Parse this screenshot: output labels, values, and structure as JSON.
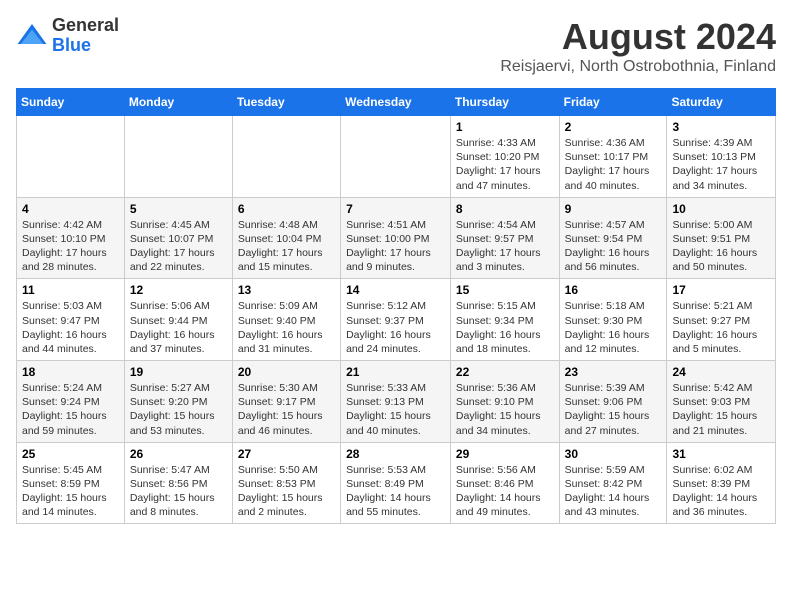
{
  "header": {
    "logo_general": "General",
    "logo_blue": "Blue",
    "month_year": "August 2024",
    "location": "Reisjaervi, North Ostrobothnia, Finland"
  },
  "weekdays": [
    "Sunday",
    "Monday",
    "Tuesday",
    "Wednesday",
    "Thursday",
    "Friday",
    "Saturday"
  ],
  "weeks": [
    [
      {
        "day": "",
        "text": ""
      },
      {
        "day": "",
        "text": ""
      },
      {
        "day": "",
        "text": ""
      },
      {
        "day": "",
        "text": ""
      },
      {
        "day": "1",
        "text": "Sunrise: 4:33 AM\nSunset: 10:20 PM\nDaylight: 17 hours and 47 minutes."
      },
      {
        "day": "2",
        "text": "Sunrise: 4:36 AM\nSunset: 10:17 PM\nDaylight: 17 hours and 40 minutes."
      },
      {
        "day": "3",
        "text": "Sunrise: 4:39 AM\nSunset: 10:13 PM\nDaylight: 17 hours and 34 minutes."
      }
    ],
    [
      {
        "day": "4",
        "text": "Sunrise: 4:42 AM\nSunset: 10:10 PM\nDaylight: 17 hours and 28 minutes."
      },
      {
        "day": "5",
        "text": "Sunrise: 4:45 AM\nSunset: 10:07 PM\nDaylight: 17 hours and 22 minutes."
      },
      {
        "day": "6",
        "text": "Sunrise: 4:48 AM\nSunset: 10:04 PM\nDaylight: 17 hours and 15 minutes."
      },
      {
        "day": "7",
        "text": "Sunrise: 4:51 AM\nSunset: 10:00 PM\nDaylight: 17 hours and 9 minutes."
      },
      {
        "day": "8",
        "text": "Sunrise: 4:54 AM\nSunset: 9:57 PM\nDaylight: 17 hours and 3 minutes."
      },
      {
        "day": "9",
        "text": "Sunrise: 4:57 AM\nSunset: 9:54 PM\nDaylight: 16 hours and 56 minutes."
      },
      {
        "day": "10",
        "text": "Sunrise: 5:00 AM\nSunset: 9:51 PM\nDaylight: 16 hours and 50 minutes."
      }
    ],
    [
      {
        "day": "11",
        "text": "Sunrise: 5:03 AM\nSunset: 9:47 PM\nDaylight: 16 hours and 44 minutes."
      },
      {
        "day": "12",
        "text": "Sunrise: 5:06 AM\nSunset: 9:44 PM\nDaylight: 16 hours and 37 minutes."
      },
      {
        "day": "13",
        "text": "Sunrise: 5:09 AM\nSunset: 9:40 PM\nDaylight: 16 hours and 31 minutes."
      },
      {
        "day": "14",
        "text": "Sunrise: 5:12 AM\nSunset: 9:37 PM\nDaylight: 16 hours and 24 minutes."
      },
      {
        "day": "15",
        "text": "Sunrise: 5:15 AM\nSunset: 9:34 PM\nDaylight: 16 hours and 18 minutes."
      },
      {
        "day": "16",
        "text": "Sunrise: 5:18 AM\nSunset: 9:30 PM\nDaylight: 16 hours and 12 minutes."
      },
      {
        "day": "17",
        "text": "Sunrise: 5:21 AM\nSunset: 9:27 PM\nDaylight: 16 hours and 5 minutes."
      }
    ],
    [
      {
        "day": "18",
        "text": "Sunrise: 5:24 AM\nSunset: 9:24 PM\nDaylight: 15 hours and 59 minutes."
      },
      {
        "day": "19",
        "text": "Sunrise: 5:27 AM\nSunset: 9:20 PM\nDaylight: 15 hours and 53 minutes."
      },
      {
        "day": "20",
        "text": "Sunrise: 5:30 AM\nSunset: 9:17 PM\nDaylight: 15 hours and 46 minutes."
      },
      {
        "day": "21",
        "text": "Sunrise: 5:33 AM\nSunset: 9:13 PM\nDaylight: 15 hours and 40 minutes."
      },
      {
        "day": "22",
        "text": "Sunrise: 5:36 AM\nSunset: 9:10 PM\nDaylight: 15 hours and 34 minutes."
      },
      {
        "day": "23",
        "text": "Sunrise: 5:39 AM\nSunset: 9:06 PM\nDaylight: 15 hours and 27 minutes."
      },
      {
        "day": "24",
        "text": "Sunrise: 5:42 AM\nSunset: 9:03 PM\nDaylight: 15 hours and 21 minutes."
      }
    ],
    [
      {
        "day": "25",
        "text": "Sunrise: 5:45 AM\nSunset: 8:59 PM\nDaylight: 15 hours and 14 minutes."
      },
      {
        "day": "26",
        "text": "Sunrise: 5:47 AM\nSunset: 8:56 PM\nDaylight: 15 hours and 8 minutes."
      },
      {
        "day": "27",
        "text": "Sunrise: 5:50 AM\nSunset: 8:53 PM\nDaylight: 15 hours and 2 minutes."
      },
      {
        "day": "28",
        "text": "Sunrise: 5:53 AM\nSunset: 8:49 PM\nDaylight: 14 hours and 55 minutes."
      },
      {
        "day": "29",
        "text": "Sunrise: 5:56 AM\nSunset: 8:46 PM\nDaylight: 14 hours and 49 minutes."
      },
      {
        "day": "30",
        "text": "Sunrise: 5:59 AM\nSunset: 8:42 PM\nDaylight: 14 hours and 43 minutes."
      },
      {
        "day": "31",
        "text": "Sunrise: 6:02 AM\nSunset: 8:39 PM\nDaylight: 14 hours and 36 minutes."
      }
    ]
  ]
}
